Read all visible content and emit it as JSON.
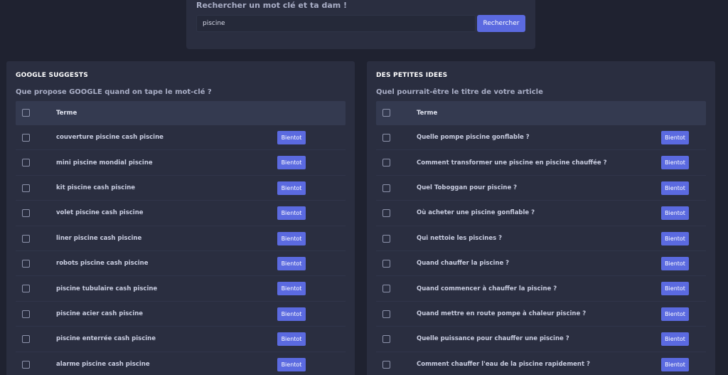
{
  "search": {
    "title": "Rechercher un mot clé et ta dam !",
    "value": "piscine",
    "button_label": "Rechercher"
  },
  "google_panel": {
    "title": "GOOGLE SUGGESTS",
    "subtitle": "Que propose GOOGLE quand on tape le mot-clé ?",
    "column_header": "Terme",
    "rows": [
      {
        "term": "couverture piscine cash piscine",
        "button": "Bientot"
      },
      {
        "term": "mini piscine mondial piscine",
        "button": "Bientot"
      },
      {
        "term": "kit piscine cash piscine",
        "button": "Bientot"
      },
      {
        "term": "volet piscine cash piscine",
        "button": "Bientot"
      },
      {
        "term": "liner piscine cash piscine",
        "button": "Bientot"
      },
      {
        "term": "robots piscine cash piscine",
        "button": "Bientot"
      },
      {
        "term": "piscine tubulaire cash piscine",
        "button": "Bientot"
      },
      {
        "term": "piscine acier cash piscine",
        "button": "Bientot"
      },
      {
        "term": "piscine enterrée cash piscine",
        "button": "Bientot"
      },
      {
        "term": "alarme piscine cash piscine",
        "button": "Bientot"
      }
    ]
  },
  "ideas_panel": {
    "title": "DES PETITES IDEES",
    "subtitle": "Quel pourrait-être le titre de votre article",
    "column_header": "Terme",
    "rows": [
      {
        "term": "Quelle pompe piscine gonflable ?",
        "button": "Bientot"
      },
      {
        "term": "Comment transformer une piscine en piscine chauffée ?",
        "button": "Bientot"
      },
      {
        "term": "Quel Toboggan pour piscine ?",
        "button": "Bientot"
      },
      {
        "term": "Où acheter une piscine gonflable ?",
        "button": "Bientot"
      },
      {
        "term": "Qui nettoie les piscines ?",
        "button": "Bientot"
      },
      {
        "term": "Quand chauffer la piscine ?",
        "button": "Bientot"
      },
      {
        "term": "Quand commencer à chauffer la piscine ?",
        "button": "Bientot"
      },
      {
        "term": "Quand mettre en route pompe à chaleur piscine ?",
        "button": "Bientot"
      },
      {
        "term": "Quelle puissance pour chauffer une piscine ?",
        "button": "Bientot"
      },
      {
        "term": "Comment chauffer l'eau de la piscine rapidement ?",
        "button": "Bientot"
      }
    ]
  },
  "colors": {
    "background": "#1f2230",
    "panel": "#2a2e40",
    "accent": "#5b6ae0"
  }
}
